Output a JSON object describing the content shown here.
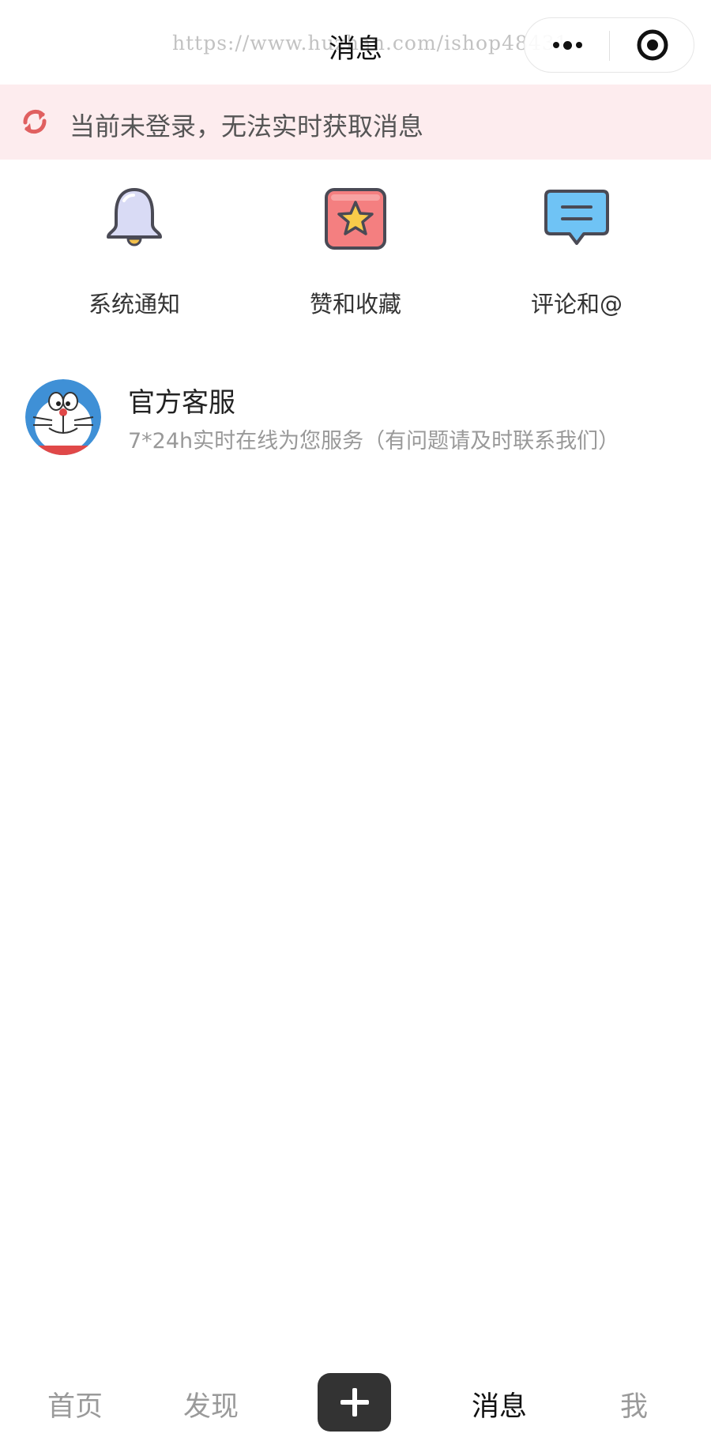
{
  "header": {
    "title": "消息",
    "watermark": "https://www.huzhan.com/ishop48431",
    "capsule": {
      "more_icon": "more-dots-icon",
      "close_icon": "target-circle-icon"
    }
  },
  "banner": {
    "icon": "refresh-icon",
    "text": "当前未登录，无法实时获取消息",
    "color": "#fdecee"
  },
  "entries": [
    {
      "label": "系统通知",
      "icon": "bell-icon"
    },
    {
      "label": "赞和收藏",
      "icon": "star-icon"
    },
    {
      "label": "评论和@",
      "icon": "comment-icon"
    }
  ],
  "service": {
    "title": "官方客服",
    "description": "7*24h实时在线为您服务（有问题请及时联系我们）",
    "avatar": "doraemon-avatar"
  },
  "tabbar": {
    "items": [
      {
        "label": "首页"
      },
      {
        "label": "发现"
      },
      {
        "label": "消息",
        "active": true
      },
      {
        "label": "我"
      }
    ],
    "add_icon": "plus-icon",
    "active_color": "#111111",
    "inactive_color": "#9a9a9a"
  }
}
